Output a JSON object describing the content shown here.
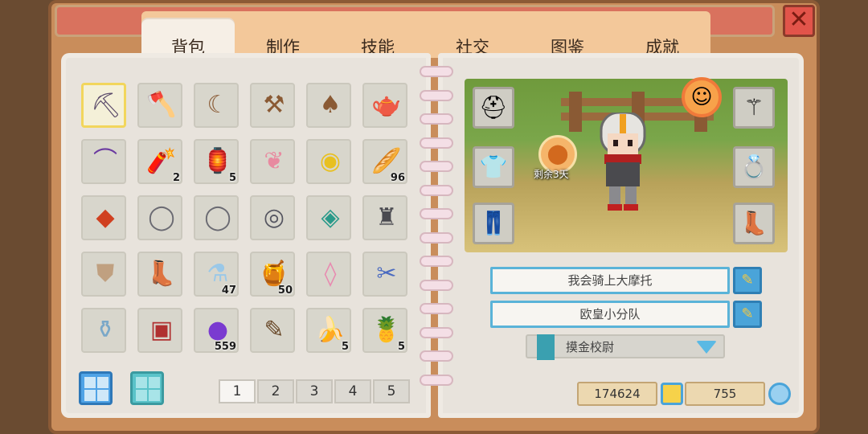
{
  "tabs": [
    "背包",
    "制作",
    "技能",
    "社交",
    "图鉴",
    "成就"
  ],
  "active_tab": 0,
  "close_label": "✕",
  "inventory": [
    {
      "name": "pickaxe-icon",
      "glyph": "⛏",
      "color": "#5a4a6a",
      "count": ""
    },
    {
      "name": "axe-icon",
      "glyph": "🪓",
      "color": "#6b4aa0",
      "count": ""
    },
    {
      "name": "sickle-icon",
      "glyph": "☾",
      "color": "#8a5a34",
      "count": ""
    },
    {
      "name": "hoe-icon",
      "glyph": "⚒",
      "color": "#8a5a34",
      "count": ""
    },
    {
      "name": "shovel-icon",
      "glyph": "♠",
      "color": "#8a5a34",
      "count": ""
    },
    {
      "name": "watering-can-icon",
      "glyph": "🫖",
      "color": "#d2893a",
      "count": ""
    },
    {
      "name": "fishing-rod-icon",
      "glyph": "⌒",
      "color": "#6b3aa0",
      "count": ""
    },
    {
      "name": "firecracker-icon",
      "glyph": "🧨",
      "color": "#c0392b",
      "count": "2"
    },
    {
      "name": "lantern-icon",
      "glyph": "🏮",
      "color": "#b03020",
      "count": "5"
    },
    {
      "name": "wings-icon",
      "glyph": "❦",
      "color": "#e88aa0",
      "count": ""
    },
    {
      "name": "slime-icon",
      "glyph": "◉",
      "color": "#e8c020",
      "count": ""
    },
    {
      "name": "bread-icon",
      "glyph": "🥖",
      "color": "#e0a030",
      "count": "96"
    },
    {
      "name": "ruby-ring-icon",
      "glyph": "◆",
      "color": "#d04020",
      "count": ""
    },
    {
      "name": "iron-ring-icon",
      "glyph": "◯",
      "color": "#6a6a72",
      "count": ""
    },
    {
      "name": "iron-ring-icon",
      "glyph": "◯",
      "color": "#6a6a72",
      "count": ""
    },
    {
      "name": "eye-ring-icon",
      "glyph": "◎",
      "color": "#555560",
      "count": ""
    },
    {
      "name": "emerald-ring-icon",
      "glyph": "◈",
      "color": "#2a9a8a",
      "count": ""
    },
    {
      "name": "horned-helmet-icon",
      "glyph": "♜",
      "color": "#4a4a50",
      "count": ""
    },
    {
      "name": "chest-armor-icon",
      "glyph": "⛊",
      "color": "#c0a080",
      "count": ""
    },
    {
      "name": "boots-icon",
      "glyph": "👢",
      "color": "#8a5a34",
      "count": ""
    },
    {
      "name": "milk-jug-icon",
      "glyph": "⚗",
      "color": "#9ac8e8",
      "count": "47"
    },
    {
      "name": "honey-jar-icon",
      "glyph": "🍯",
      "color": "#e0a030",
      "count": "50"
    },
    {
      "name": "crystal-icon",
      "glyph": "◊",
      "color": "#e88ab0",
      "count": ""
    },
    {
      "name": "scissors-icon",
      "glyph": "✂",
      "color": "#4a6ac0",
      "count": ""
    },
    {
      "name": "glass-jar-icon",
      "glyph": "⚱",
      "color": "#7aa8c8",
      "count": ""
    },
    {
      "name": "treasure-chest-icon",
      "glyph": "▣",
      "color": "#b03030",
      "count": ""
    },
    {
      "name": "purple-orb-icon",
      "glyph": "●",
      "color": "#7a3ad0",
      "count": "559"
    },
    {
      "name": "root-icon",
      "glyph": "✎",
      "color": "#6a4a2a",
      "count": ""
    },
    {
      "name": "banana-icon",
      "glyph": "🍌",
      "color": "#e8c020",
      "count": "5"
    },
    {
      "name": "pineapple-icon",
      "glyph": "🍍",
      "color": "#e8901a",
      "count": "5"
    }
  ],
  "pages": [
    "1",
    "2",
    "3",
    "4",
    "5"
  ],
  "active_page": 0,
  "equipment": {
    "left": [
      "hood-icon",
      "shirt-icon",
      "pants-icon"
    ],
    "right": [
      "wand-icon",
      "amethyst-ring-icon",
      "red-boots-icon"
    ]
  },
  "timer_label": "剩余3天",
  "name_field": "我会骑上大摩托",
  "farm_field": "欧皇小分队",
  "title_select": "摸金校尉",
  "gold": "174624",
  "gems": "755"
}
